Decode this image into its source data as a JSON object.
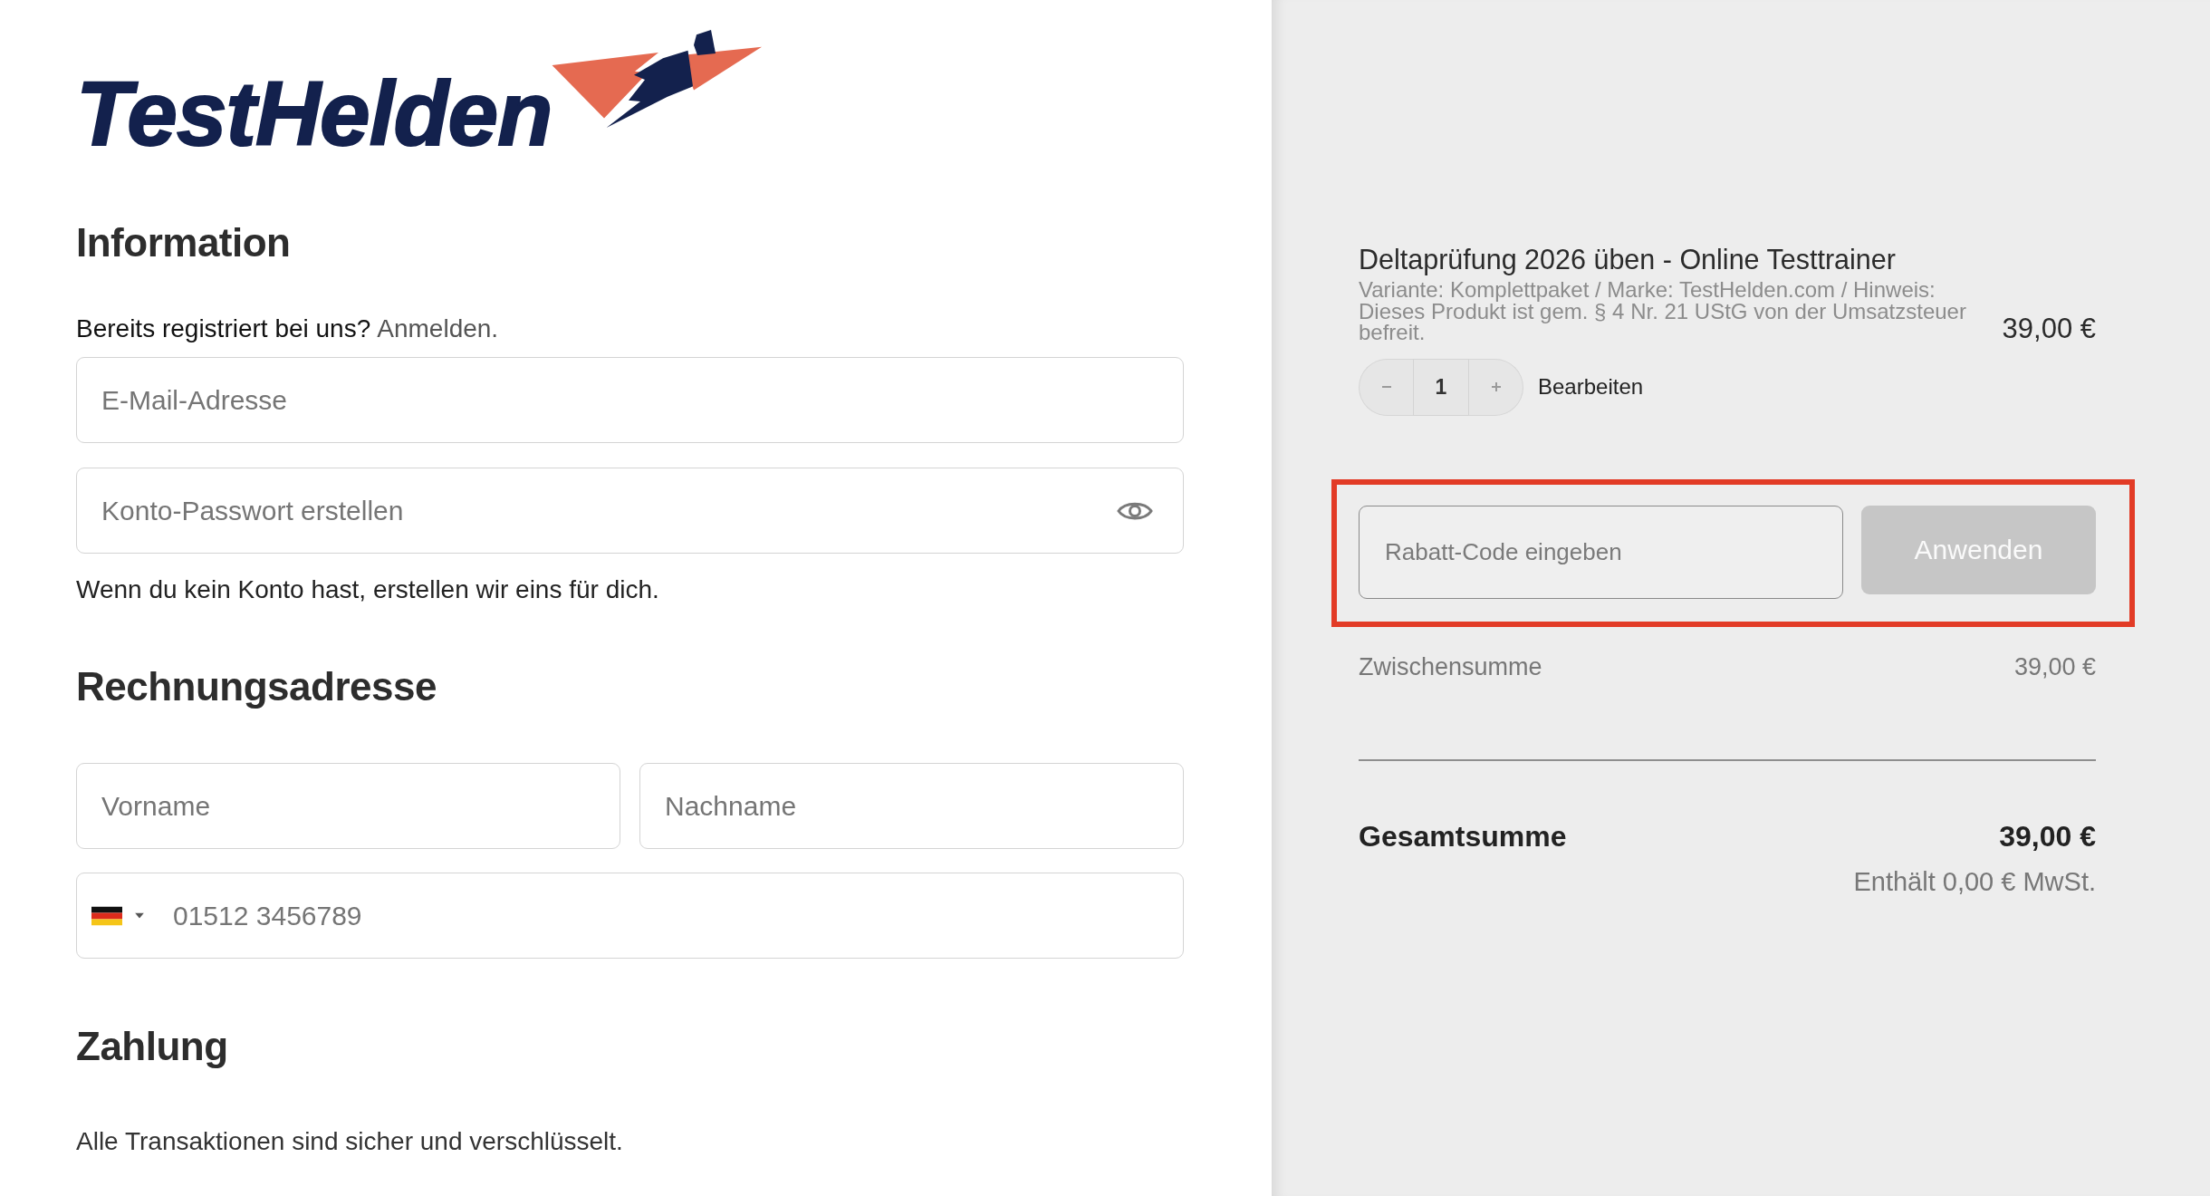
{
  "logo": {
    "wordmark": "TestHelden"
  },
  "information": {
    "heading": "Information",
    "login_prompt": "Bereits registriert bei uns?",
    "login_link": "Anmelden.",
    "email": {
      "placeholder": "E-Mail-Adresse"
    },
    "password": {
      "placeholder": "Konto-Passwort erstellen"
    },
    "note": "Wenn du kein Konto hast, erstellen wir eins für dich."
  },
  "billing_address": {
    "heading": "Rechnungsadresse",
    "first_name": {
      "placeholder": "Vorname"
    },
    "last_name": {
      "placeholder": "Nachname"
    },
    "phone": {
      "placeholder": "01512 3456789"
    }
  },
  "payment": {
    "heading": "Zahlung",
    "note": "Alle Transaktionen sind sicher und verschlüsselt."
  },
  "order_summary": {
    "items": [
      {
        "title": "Deltaprüfung 2026 üben - Online Testtrainer",
        "details": "Variante: Komplettpaket / Marke: TestHelden.com / Hinweis: Dieses Produkt ist gem. § 4 Nr. 21 UStG von der Umsatzsteuer befreit.",
        "price": "39,00 €",
        "quantity": "1",
        "edit_link": "Bearbeiten"
      }
    ],
    "coupon": {
      "placeholder": "Rabatt-Code eingeben",
      "button": "Anwenden",
      "button_disabled": true,
      "highlighted": true
    },
    "subtotal": {
      "label": "Zwischensumme",
      "value": "39,00 €"
    },
    "total": {
      "label": "Gesamtsumme",
      "value": "39,00 €",
      "tax_note": "Enthält 0,00 € MwSt."
    }
  }
}
